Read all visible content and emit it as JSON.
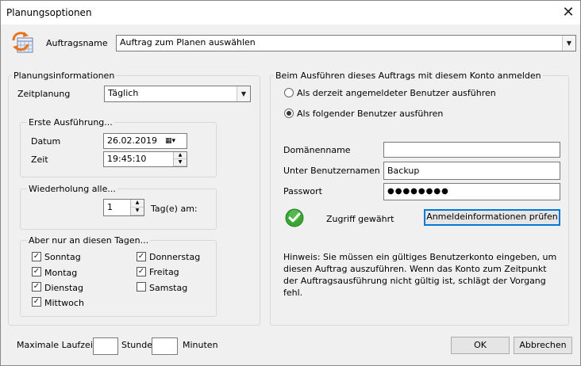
{
  "window": {
    "title": "Planungsoptionen",
    "close_glyph": "✕"
  },
  "job": {
    "label": "Auftragsname",
    "value": "Auftrag zum Planen auswählen"
  },
  "planning": {
    "group_label": "Planungsinformationen",
    "schedule_label": "Zeitplanung",
    "schedule_value": "Täglich",
    "first_run": {
      "group_label": "Erste Ausführung...",
      "date_label": "Datum",
      "date_value": "26.02.2019",
      "time_label": "Zeit",
      "time_value": "19:45:10"
    },
    "repeat": {
      "group_label": "Wiederholung alle...",
      "value": "1",
      "unit_label": "Tag(e) am:"
    },
    "days": {
      "group_label": "Aber nur an diesen Tagen...",
      "items": [
        {
          "label": "Sonntag",
          "checked": true
        },
        {
          "label": "Montag",
          "checked": true
        },
        {
          "label": "Dienstag",
          "checked": true
        },
        {
          "label": "Mittwoch",
          "checked": true
        },
        {
          "label": "Donnerstag",
          "checked": true
        },
        {
          "label": "Freitag",
          "checked": true
        },
        {
          "label": "Samstag",
          "checked": false
        }
      ]
    }
  },
  "account": {
    "group_label": "Beim Ausführen dieses Auftrags mit diesem Konto anmelden",
    "radio_current": "Als derzeit angemeldeter Benutzer ausführen",
    "radio_following": "Als folgender Benutzer ausführen",
    "selected": "following",
    "domain_label": "Domänenname",
    "domain_value": "",
    "user_label": "Unter Benutzernamen",
    "user_value": "Backup",
    "password_label": "Passwort",
    "password_value": "●●●●●●●●",
    "access_status": "Zugriff gewährt",
    "check_button": "Anmeldeinformationen prüfen",
    "hint": "Hinweis: Sie müssen ein gültiges Benutzerkonto eingeben, um diesen Auftrag auszuführen. Wenn das Konto zum Zeitpunkt der Auftragsausführung nicht gültig ist, schlägt der Vorgang fehl."
  },
  "footer": {
    "max_runtime_label": "Maximale Laufzeit:",
    "hours_value": "",
    "hours_label": "Stunde",
    "minutes_value": "",
    "minutes_label": "Minuten",
    "ok_button": "OK",
    "cancel_button": "Abbrechen"
  },
  "colors": {
    "accent": "#0078d7",
    "success": "#3aa534"
  }
}
